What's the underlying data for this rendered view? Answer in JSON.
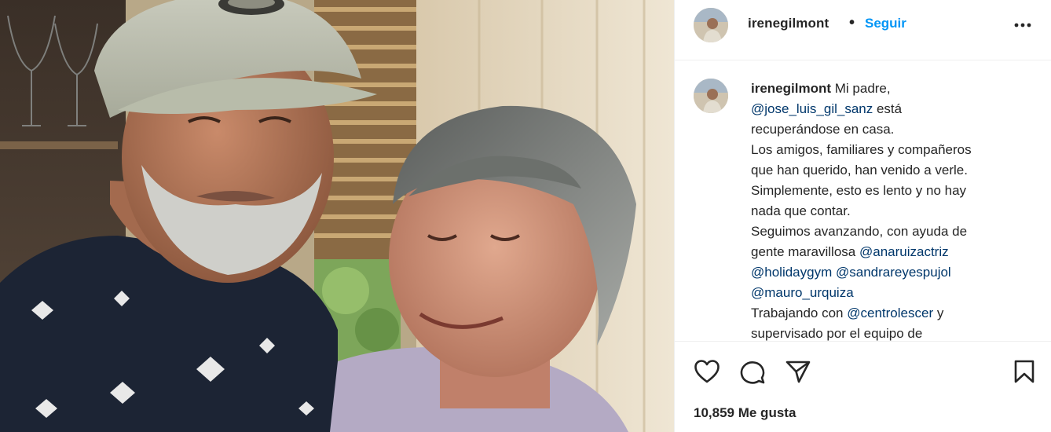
{
  "post": {
    "photo_alt_icon": "post-photo"
  },
  "header": {
    "username": "irenegilmont",
    "separator": "•",
    "follow_label": "Seguir",
    "more_icon": "more-dots-icon"
  },
  "caption": {
    "username": "irenegilmont",
    "line1_text": "Mi padre,",
    "mention1": "@jose_luis_gil_sanz",
    "line2_tail": "está",
    "line3": "recuperándose en casa.",
    "line4": "Los amigos, familiares y compañeros",
    "line5": "que han querido, han venido a verle.",
    "line6": "Simplemente, esto es lento y no hay",
    "line7": "nada que contar.",
    "line8": "Seguimos avanzando, con ayuda de",
    "line9_text": "gente maravillosa",
    "mention2": "@anaruizactriz",
    "mention3": "@holidaygym",
    "mention4": "@sandrareyespujol",
    "mention5": "@mauro_urquiza",
    "line12_text": "Trabajando con",
    "mention6": "@centrolescer",
    "line12_tail": "y",
    "line13": "supervisado por el equipo de"
  },
  "actions": {
    "like_icon": "heart-icon",
    "comment_icon": "comment-icon",
    "share_icon": "share-icon",
    "save_icon": "bookmark-icon",
    "likes_text": "10,859 Me gusta"
  }
}
